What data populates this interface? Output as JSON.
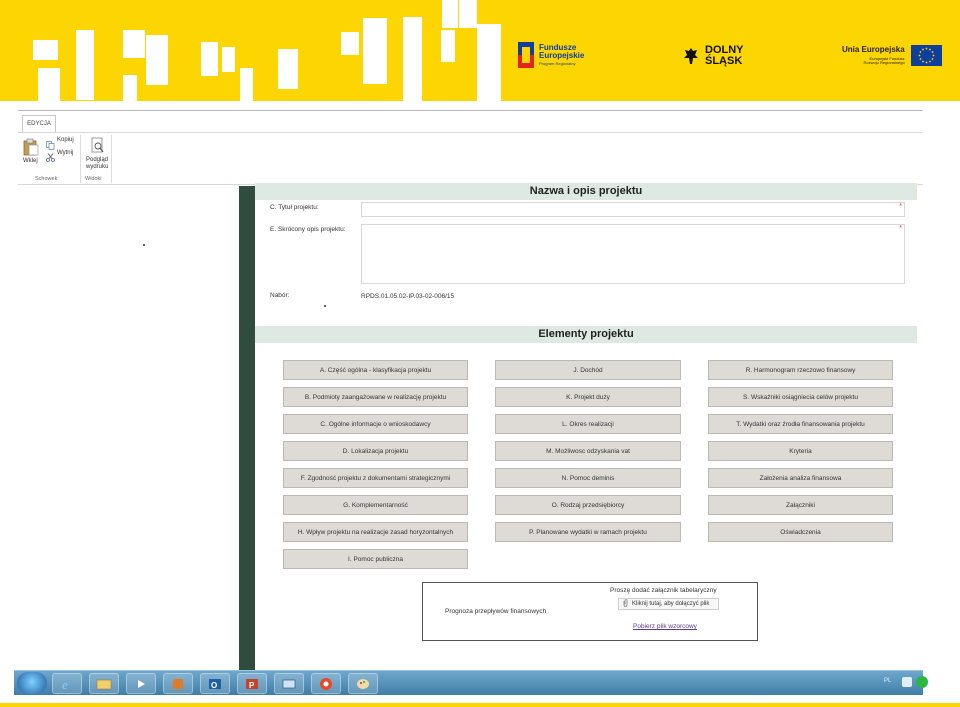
{
  "banner": {
    "logo_fe": {
      "line1": "Fundusze",
      "line2": "Europejskie",
      "line3": "Program Regionalny"
    },
    "logo_ds": {
      "line1": "DOLNY",
      "line2": "ŚLĄSK"
    },
    "logo_ue": {
      "line1": "Unia Europejska",
      "line2": "Europejski Fundusz",
      "line3": "Rozwoju Regionalnego"
    },
    "colors": {
      "yellow": "#fdd500",
      "eu_blue": "#0e3f9c",
      "eu_stars": "#fdd500"
    }
  },
  "ribbon": {
    "tab": "EDYCJA",
    "paste_label": "Wklej",
    "copy_label": "Kopiuj",
    "cut_label": "Wytnij",
    "preview_label_1": "Podgląd",
    "preview_label_2": "wydruku",
    "group_clipboard": "Schowek",
    "group_views": "Widoki"
  },
  "section1": {
    "header": "Nazwa i opis projektu",
    "title_label": "C. Tytuł projektu:",
    "title_value": "",
    "desc_label": "E. Skrócony opis projektu:",
    "desc_value": "",
    "required_mark": "*",
    "nabor_label": "Nabór:",
    "nabor_value": "RPDS.01.05.02-IP.03-02-006/15"
  },
  "section2": {
    "header": "Elementy projektu",
    "buttons": [
      [
        "A. Część ogólna - klasyfikacja projektu",
        "J. Dochód",
        "R. Harmonogram rzeczowo finansowy"
      ],
      [
        "B. Podmioty zaangażowane w realizację projektu",
        "K. Projekt duży",
        "S. Wskaźniki osiągniecia celów projektu"
      ],
      [
        "C. Ogólne informacje o wnioskodawcy",
        "L. Okres realizacji",
        "T. Wydatki oraz źrodła finansowania projektu"
      ],
      [
        "D. Lokalizacja projektu",
        "M. Możliwosc odzyskania vat",
        "Kryteria"
      ],
      [
        "F. Zgodność projektu z dokumentami strategicznymi",
        "N. Pomoc deminis",
        "Założenia analiza finansowa"
      ],
      [
        "G. Komplementarność",
        "O. Rodzaj przedsiębiorcy",
        "Załączniki"
      ],
      [
        "H. Wpływ projektu na realizacje zasad horyzontalnych",
        "P. Planowane wydatki w ramach projektu",
        "Oświadczenia"
      ],
      [
        "I. Pomoc publiczna",
        "",
        ""
      ]
    ]
  },
  "attachment": {
    "title": "Proszę dodać załącznik tabelaryczny",
    "label": "Prognoza przepływów finansowych",
    "attach_button": "Kliknij tutaj, aby dołączyć plik",
    "download_link": "Pobierz plik wzorcowy"
  },
  "taskbar": {
    "lang": "PL",
    "apps": [
      "start-orb",
      "internet-explorer",
      "file-explorer",
      "media-player",
      "app-store",
      "outlook",
      "powerpoint",
      "remote-desktop",
      "chrome",
      "paint"
    ]
  }
}
